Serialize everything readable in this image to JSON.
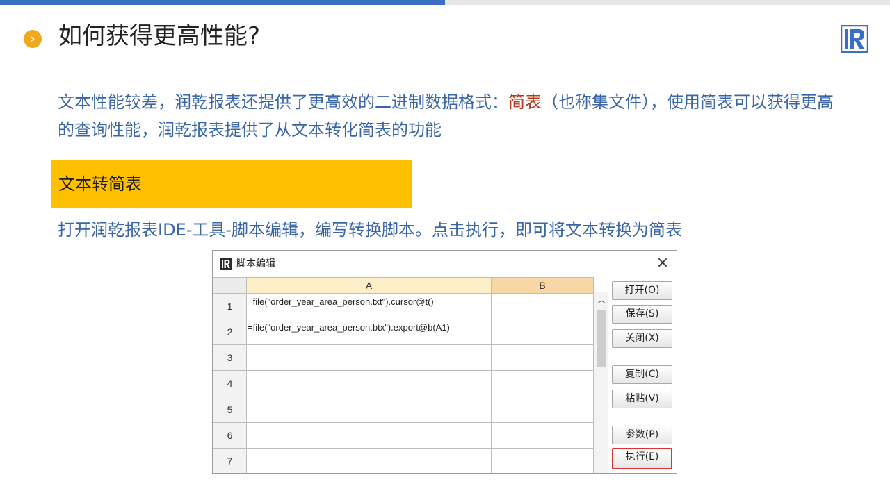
{
  "slide": {
    "title": "如何获得更高性能?",
    "paragraph": {
      "part1": "文本性能较差，润乾报表还提供了更高效的二进制数据格式：",
      "highlight": "简表",
      "part2": "（也称集文件），使用简表可以获得更高的查询性能，润乾报表提供了从文本转化简表的功能"
    },
    "section_label": "文本转简表",
    "instruction": "打开润乾报表IDE-工具-脚本编辑，编写转换脚本。点击执行，即可将文本转换为简表",
    "colors": {
      "accent_blue": "#3a6fc4",
      "bullet_orange": "#f0a81c",
      "section_yellow": "#ffc000",
      "text_blue": "#3a66a8",
      "highlight_red": "#b8381c"
    }
  },
  "dialog": {
    "title": "脚本编辑",
    "close_icon": "close-icon",
    "columns": [
      "A",
      "B"
    ],
    "rows": [
      {
        "num": "1",
        "a": "=file(\"order_year_area_person.txt\").cursor@t()",
        "b": ""
      },
      {
        "num": "2",
        "a": "=file(\"order_year_area_person.btx\").export@b(A1)",
        "b": ""
      },
      {
        "num": "3",
        "a": "",
        "b": ""
      },
      {
        "num": "4",
        "a": "",
        "b": ""
      },
      {
        "num": "5",
        "a": "",
        "b": ""
      },
      {
        "num": "6",
        "a": "",
        "b": ""
      },
      {
        "num": "7",
        "a": "",
        "b": ""
      }
    ],
    "buttons": {
      "open": "打开(O)",
      "save": "保存(S)",
      "close": "关闭(X)",
      "copy": "复制(C)",
      "paste": "粘贴(V)",
      "params": "参数(P)",
      "execute": "执行(E)"
    }
  }
}
